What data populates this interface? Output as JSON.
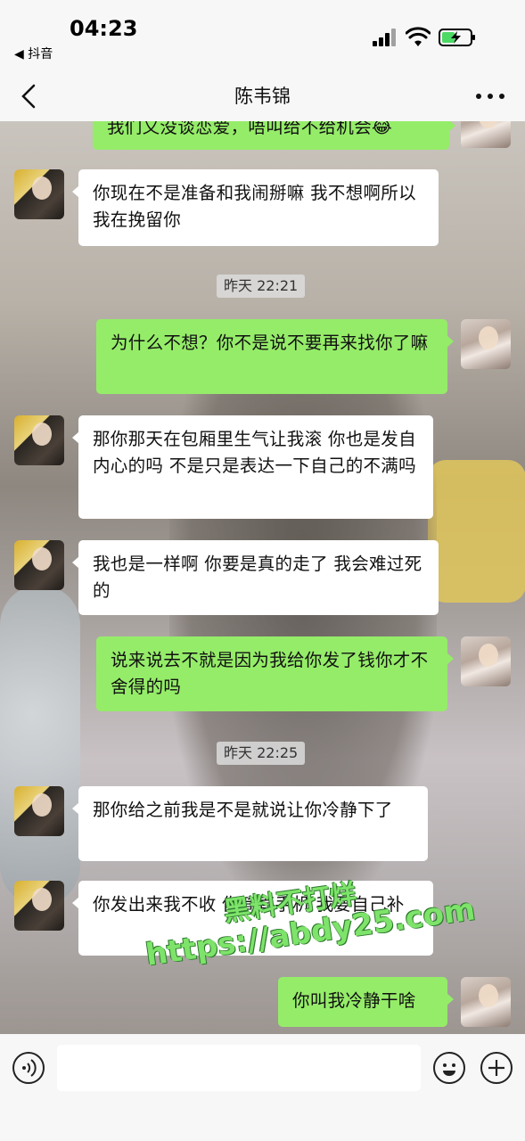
{
  "status_bar": {
    "time": "04:23",
    "back_app": "◀ 抖音"
  },
  "nav": {
    "title": "陈韦锦"
  },
  "messages": [
    {
      "side": "right",
      "text": "我们又没谈恋爱，唔叫给不给机会😂"
    },
    {
      "side": "left",
      "text": "你现在不是准备和我闹掰嘛 我不想啊所以我在挽留你"
    },
    {
      "type": "time",
      "text": "昨天 22:21"
    },
    {
      "side": "right",
      "text": "为什么不想？你不是说不要再来找你了嘛"
    },
    {
      "side": "left",
      "text": "那你那天在包厢里生气让我滚 你也是发自内心的吗 不是只是表达一下自己的不满吗"
    },
    {
      "side": "left",
      "text": "我也是一样啊 你要是真的走了 我会难过死的"
    },
    {
      "side": "right",
      "text": "说来说去不就是因为我给你发了钱你才不舍得的吗"
    },
    {
      "type": "time",
      "text": "昨天 22:25"
    },
    {
      "side": "left",
      "text": "那你给之前我是不是就说让你冷静下了"
    },
    {
      "side": "left",
      "text": "你发出来我不收 你简直手机 我要自己补"
    },
    {
      "side": "right",
      "text": "你叫我冷静干啥"
    }
  ],
  "watermark": {
    "line1": "黑料不打烊",
    "line2": "https://abdy25.com"
  },
  "colors": {
    "my_bubble": "#95ec69",
    "their_bubble": "#ffffff",
    "bar_bg": "#f7f7f7"
  }
}
